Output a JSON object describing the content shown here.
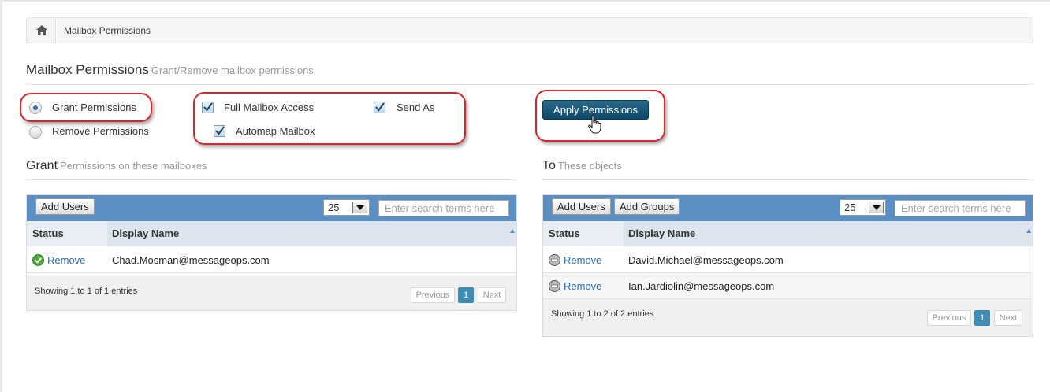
{
  "breadcrumb": {
    "current": "Mailbox Permissions"
  },
  "page": {
    "title": "Mailbox Permissions",
    "subtitle": "Grant/Remove mailbox permissions."
  },
  "mode": {
    "grant_label": "Grant Permissions",
    "remove_label": "Remove Permissions",
    "selected": "grant"
  },
  "permissions": {
    "full_access": {
      "label": "Full Mailbox Access",
      "checked": true
    },
    "send_as": {
      "label": "Send As",
      "checked": true
    },
    "automap": {
      "label": "Automap Mailbox",
      "checked": true
    }
  },
  "apply_button": "Apply Permissions",
  "grant": {
    "title": "Grant",
    "subtitle": "Permissions on these mailboxes",
    "add_users": "Add Users",
    "page_size": "25",
    "search_placeholder": "Enter search terms here",
    "col_status": "Status",
    "col_name": "Display Name",
    "rows": [
      {
        "status": "granted",
        "action": "Remove",
        "name": "Chad.Mosman@messageops.com"
      }
    ],
    "info": "Showing 1 to 1 of 1 entries",
    "prev": "Previous",
    "page": "1",
    "next": "Next"
  },
  "to": {
    "title": "To",
    "subtitle": "These objects",
    "add_users": "Add Users",
    "add_groups": "Add Groups",
    "page_size": "25",
    "search_placeholder": "Enter search terms here",
    "col_status": "Status",
    "col_name": "Display Name",
    "rows": [
      {
        "status": "pending",
        "action": "Remove",
        "name": "David.Michael@messageops.com"
      },
      {
        "status": "pending",
        "action": "Remove",
        "name": "Ian.Jardiolin@messageops.com"
      }
    ],
    "info": "Showing 1 to 2 of 2 entries",
    "prev": "Previous",
    "page": "1",
    "next": "Next"
  },
  "colors": {
    "toolbar": "#5b8ec2",
    "accent": "#0e4766",
    "highlight": "#d9262c",
    "link": "#2a6fb0"
  }
}
